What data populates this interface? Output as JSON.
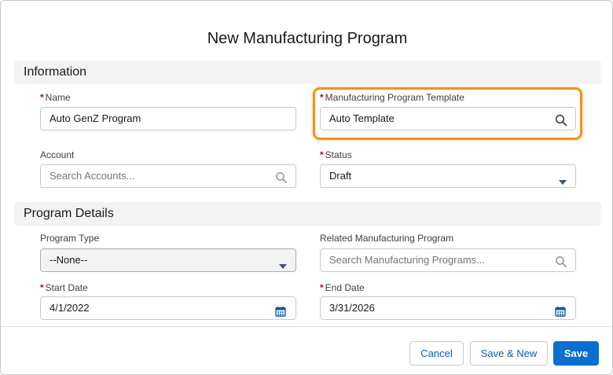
{
  "modal": {
    "title": "New Manufacturing Program"
  },
  "sections": {
    "information": "Information",
    "program_details": "Program Details"
  },
  "fields": {
    "name": {
      "label": "Name",
      "value": "Auto GenZ Program",
      "required": "*"
    },
    "template": {
      "label": "Manufacturing Program Template",
      "value": "Auto Template",
      "required": "*"
    },
    "account": {
      "label": "Account",
      "placeholder": "Search Accounts..."
    },
    "status": {
      "label": "Status",
      "value": "Draft",
      "required": "*"
    },
    "program_type": {
      "label": "Program Type",
      "value": "--None--"
    },
    "related_program": {
      "label": "Related Manufacturing Program",
      "placeholder": "Search Manufacturing Programs..."
    },
    "start_date": {
      "label": "Start Date",
      "value": "4/1/2022",
      "required": "*"
    },
    "end_date": {
      "label": "End Date",
      "value": "3/31/2026",
      "required": "*"
    }
  },
  "footer": {
    "cancel": "Cancel",
    "save_new": "Save & New",
    "save": "Save"
  },
  "colors": {
    "highlight": "#f0931f",
    "brand_button": "#0b6fce",
    "required": "#ba0517"
  },
  "icons": [
    "search-icon",
    "chevron-down-icon",
    "calendar-icon"
  ]
}
